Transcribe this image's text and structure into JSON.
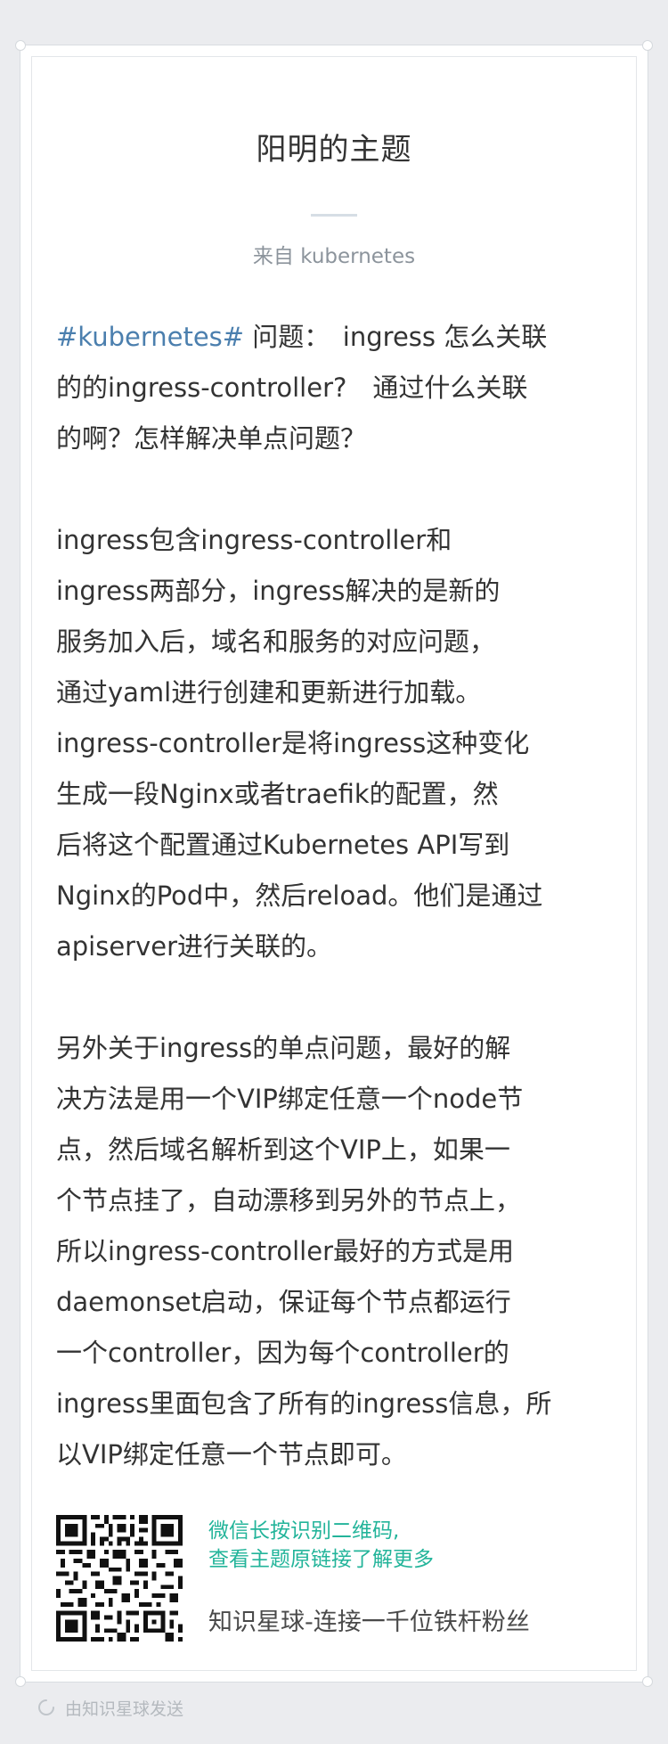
{
  "topic": {
    "title": "阳明的主题",
    "source": "来自 kubernetes"
  },
  "post": {
    "hashtag": "#kubernetes#",
    "question_lines": [
      " 问题：　ingress 怎么关联",
      "的的ingress-controller?　通过什么关联",
      "的啊？怎样解决单点问题？"
    ],
    "answer1_lines": [
      "ingress包含ingress-controller和",
      "ingress两部分，ingress解决的是新的",
      "服务加入后，域名和服务的对应问题，",
      "通过yaml进行创建和更新进行加载。",
      "ingress-controller是将ingress这种变化",
      "生成一段Nginx或者traefik的配置，然",
      "后将这个配置通过Kubernetes API写到",
      "Nginx的Pod中，然后reload。他们是通过",
      "apiserver进行关联的。"
    ],
    "answer2_lines": [
      "另外关于ingress的单点问题，最好的解",
      "决方法是用一个VIP绑定任意一个node节",
      "点，然后域名解析到这个VIP上，如果一",
      "个节点挂了，自动漂移到另外的节点上，",
      "所以ingress-controller最好的方式是用",
      "daemonset启动，保证每个节点都运行",
      "一个controller，因为每个controller的",
      "ingress里面包含了所有的ingress信息，所",
      "以VIP绑定任意一个节点即可。"
    ]
  },
  "footer": {
    "qr_icon": "qr-code-icon",
    "qr_tip_line1": "微信长按识别二维码,",
    "qr_tip_line2": "查看主题原链接了解更多",
    "brand": "知识星球-连接一千位铁杆粉丝"
  },
  "bottom": {
    "icon": "loading-spinner-icon",
    "text": "由知识星球发送"
  },
  "colors": {
    "background": "#ebecef",
    "card": "#ffffff",
    "hashtag": "#4b7fae",
    "tip": "#23b49a",
    "text": "#333333",
    "muted": "#8c949c"
  }
}
